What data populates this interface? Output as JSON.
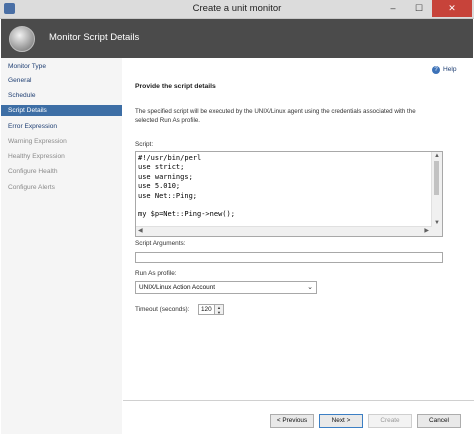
{
  "window": {
    "title": "Create a unit monitor",
    "minimize": "–",
    "maximize": "☐",
    "close": "✕"
  },
  "header": {
    "title": "Monitor Script Details"
  },
  "sidebar": {
    "items": [
      {
        "label": "Monitor Type",
        "state": "enabled"
      },
      {
        "label": "General",
        "state": "enabled"
      },
      {
        "label": "Schedule",
        "state": "enabled"
      },
      {
        "label": "Script Details",
        "state": "selected"
      },
      {
        "label": "Error Expression",
        "state": "enabled"
      },
      {
        "label": "Warning Expression",
        "state": "disabled"
      },
      {
        "label": "Healthy Expression",
        "state": "disabled"
      },
      {
        "label": "Configure Health",
        "state": "disabled"
      },
      {
        "label": "Configure Alerts",
        "state": "disabled"
      }
    ]
  },
  "help": {
    "label": "Help",
    "icon": "help-icon"
  },
  "content": {
    "title": "Provide the script details",
    "description": "The specified script will be executed by the UNIX/Linux agent using the credentials associated with the selected Run As profile.",
    "script_label": "Script:",
    "script_value": "#!/usr/bin/perl\nuse strict;\nuse warnings;\nuse 5.010;\nuse Net::Ping;\n\nmy $p=Net::Ping->new();",
    "args_label": "Script Arguments:",
    "args_value": "",
    "runas_label": "Run As profile:",
    "runas_value": "UNIX/Linux Action Account",
    "timeout_label": "Timeout (seconds):",
    "timeout_value": "120"
  },
  "buttons": {
    "previous": "< Previous",
    "next": "Next >",
    "create": "Create",
    "cancel": "Cancel"
  },
  "colors": {
    "accent": "#3d6ea5",
    "header_bg": "#4b4b4b",
    "close": "#c7433a"
  }
}
